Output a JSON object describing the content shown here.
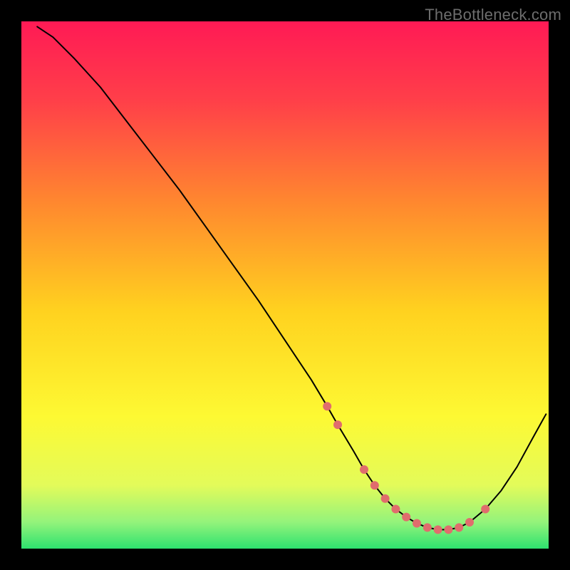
{
  "watermark": "TheBottleneck.com",
  "chart_data": {
    "type": "line",
    "title": "",
    "xlabel": "",
    "ylabel": "",
    "xlim": [
      0,
      100
    ],
    "ylim": [
      0,
      100
    ],
    "background_gradient": {
      "type": "vertical",
      "stops": [
        {
          "offset": 0.0,
          "color": "#ff1a55"
        },
        {
          "offset": 0.15,
          "color": "#ff3f49"
        },
        {
          "offset": 0.35,
          "color": "#ff8a2e"
        },
        {
          "offset": 0.55,
          "color": "#ffd21f"
        },
        {
          "offset": 0.75,
          "color": "#fdf933"
        },
        {
          "offset": 0.88,
          "color": "#e3fb5a"
        },
        {
          "offset": 0.95,
          "color": "#93f37b"
        },
        {
          "offset": 1.0,
          "color": "#2ee26f"
        }
      ]
    },
    "series": [
      {
        "name": "curve",
        "color": "#000000",
        "stroke_width": 2,
        "x": [
          3,
          6,
          10,
          15,
          20,
          25,
          30,
          35,
          40,
          45,
          50,
          55,
          58,
          60,
          63,
          65,
          67,
          69,
          71,
          73,
          75,
          77,
          79,
          81,
          83,
          85,
          88,
          91,
          94,
          97,
          99.5
        ],
        "y": [
          99,
          97,
          93,
          87.5,
          81,
          74.5,
          68,
          61,
          54,
          47,
          39.5,
          32,
          27,
          23.5,
          18.5,
          15,
          12,
          9.5,
          7.5,
          6,
          4.8,
          4,
          3.6,
          3.6,
          4,
          5,
          7.5,
          11,
          15.5,
          21,
          25.5
        ]
      }
    ],
    "markers": {
      "name": "highlight-dots",
      "color": "#e06d6d",
      "radius": 6,
      "x": [
        58,
        60,
        65,
        67,
        69,
        71,
        73,
        75,
        77,
        79,
        81,
        83,
        85,
        88
      ],
      "y": [
        27,
        23.5,
        15,
        12,
        9.5,
        7.5,
        6,
        4.8,
        4,
        3.6,
        3.6,
        4,
        5,
        7.5
      ]
    }
  }
}
